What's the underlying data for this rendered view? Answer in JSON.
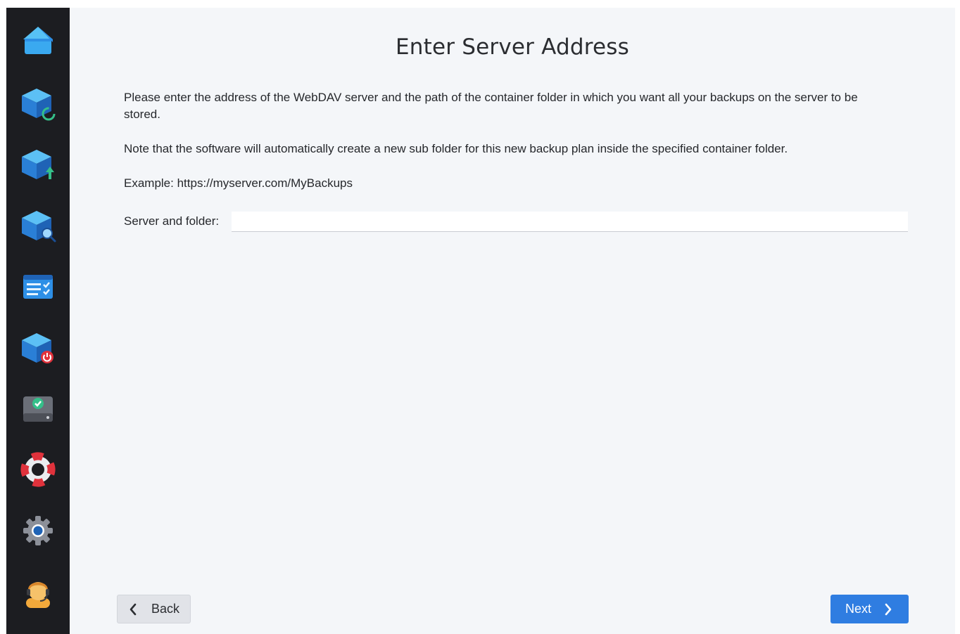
{
  "sidebar": {
    "items": [
      {
        "icon": "home-icon"
      },
      {
        "icon": "backup-refresh-icon"
      },
      {
        "icon": "backup-upload-icon"
      },
      {
        "icon": "backup-search-icon"
      },
      {
        "icon": "checklist-icon"
      },
      {
        "icon": "backup-power-icon"
      },
      {
        "icon": "drive-check-icon"
      },
      {
        "icon": "lifebuoy-icon"
      },
      {
        "icon": "gear-icon"
      },
      {
        "icon": "support-agent-icon"
      }
    ]
  },
  "main": {
    "title": "Enter Server Address",
    "intro": "Please enter the address of the WebDAV server and the path of the container folder in which you want all your backups on the server to be stored.",
    "note": "Note that the software will automatically create a new sub folder for this new backup plan inside the specified container folder.",
    "example": "Example: https://myserver.com/MyBackups",
    "field": {
      "label": "Server and folder:",
      "value": "",
      "placeholder": ""
    }
  },
  "footer": {
    "back_label": "Back",
    "next_label": "Next"
  },
  "colors": {
    "sidebar_bg": "#1c1d21",
    "content_bg": "#f4f6f9",
    "accent": "#2f7de1",
    "icon_blue": "#2d8fe6"
  }
}
